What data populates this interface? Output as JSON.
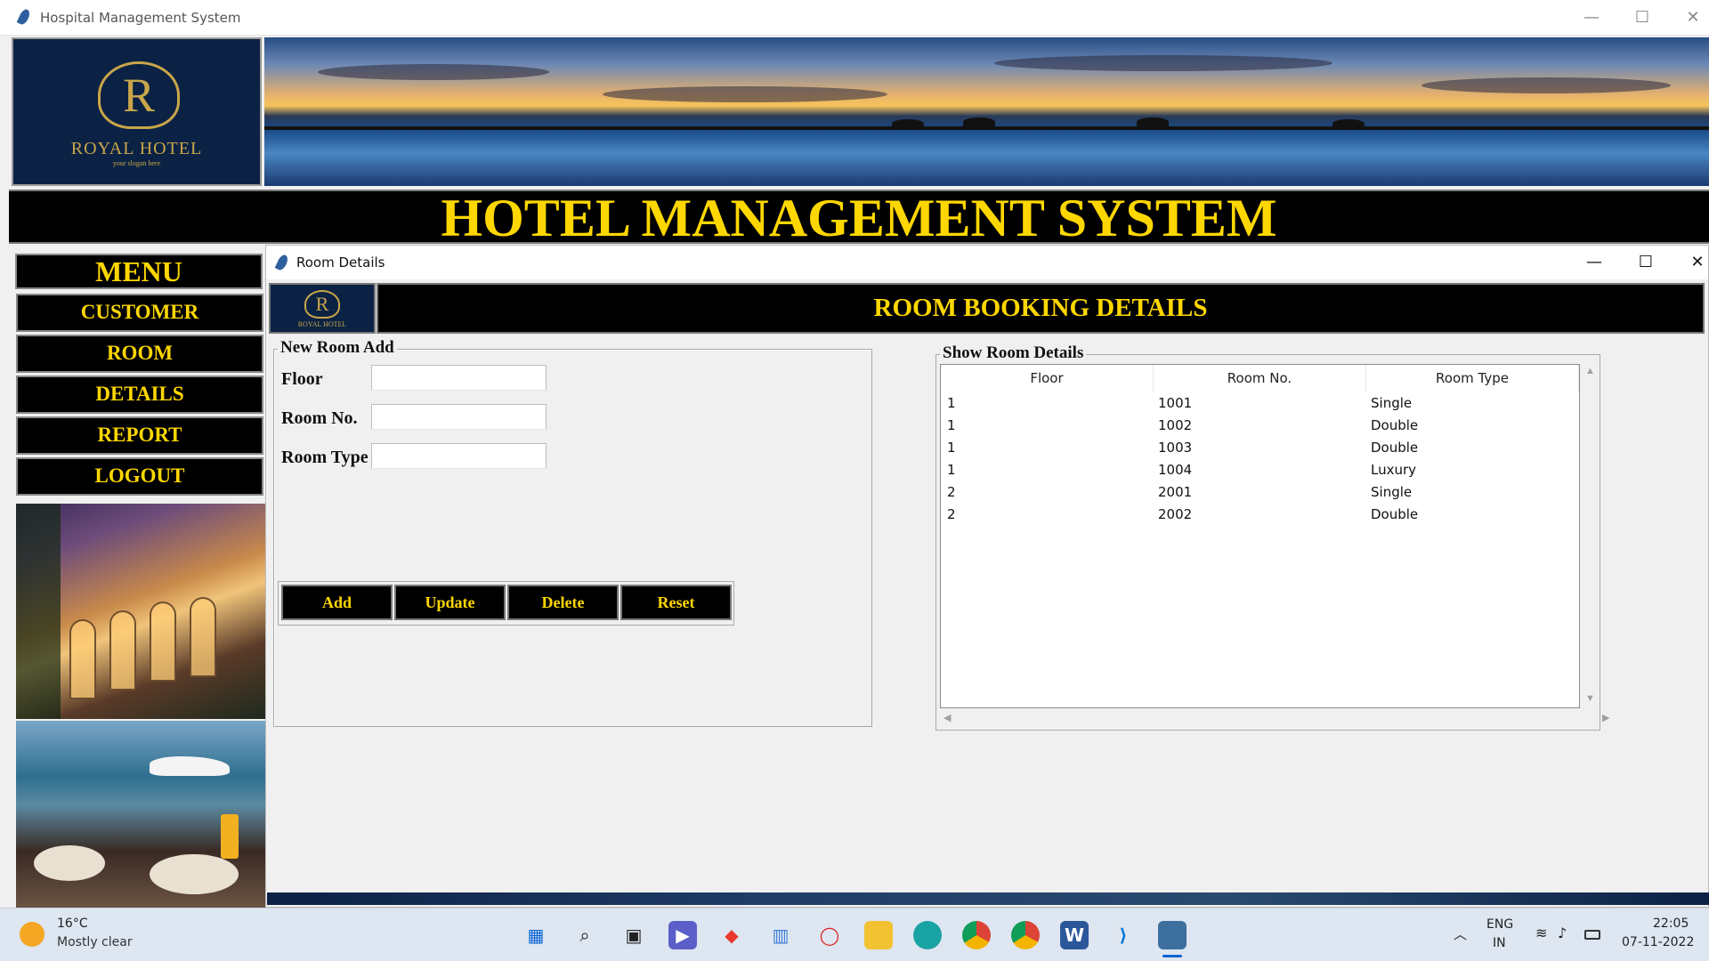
{
  "app": {
    "window_title": "Hospital Management System",
    "logo_name": "ROYAL HOTEL",
    "logo_slogan": "your slogan here",
    "logo_letter": "R",
    "main_title": "HOTEL MANAGEMENT SYSTEM"
  },
  "menu": {
    "title": "MENU",
    "items": [
      {
        "label": "CUSTOMER"
      },
      {
        "label": "ROOM"
      },
      {
        "label": "DETAILS"
      },
      {
        "label": "REPORT"
      },
      {
        "label": "LOGOUT"
      }
    ]
  },
  "room_window": {
    "title": "Room Details",
    "header": "ROOM BOOKING DETAILS",
    "logo_name": "ROYAL HOTEL",
    "new_room": {
      "frame_label": "New Room Add",
      "fields": [
        {
          "label": "Floor",
          "value": ""
        },
        {
          "label": "Room No.",
          "value": ""
        },
        {
          "label": "Room Type",
          "value": ""
        }
      ],
      "buttons": {
        "add": "Add",
        "update": "Update",
        "delete": "Delete",
        "reset": "Reset"
      }
    },
    "show_rooms": {
      "frame_label": "Show Room Details",
      "columns": [
        "Floor",
        "Room No.",
        "Room Type"
      ],
      "rows": [
        [
          "1",
          "1001",
          "Single"
        ],
        [
          "1",
          "1002",
          "Double"
        ],
        [
          "1",
          "1003",
          "Double"
        ],
        [
          "1",
          "1004",
          "Luxury"
        ],
        [
          "2",
          "2001",
          "Single"
        ],
        [
          "2",
          "2002",
          "Double"
        ]
      ]
    }
  },
  "window_controls": {
    "minimize": "—",
    "maximize": "☐",
    "close": "✕"
  },
  "taskbar": {
    "weather_temp": "16°C",
    "weather_desc": "Mostly clear",
    "lang_top": "ENG",
    "lang_bottom": "IN",
    "time": "22:05",
    "date": "07-11-2022",
    "apps": [
      "start",
      "search",
      "task-view",
      "chat",
      "office",
      "monitor",
      "opera",
      "file-explorer",
      "edge",
      "chrome",
      "chrome-profile",
      "word",
      "vscode",
      "python"
    ]
  },
  "colors": {
    "accent_yellow": "#ffd700",
    "navy": "#0b2244",
    "black": "#000000"
  }
}
